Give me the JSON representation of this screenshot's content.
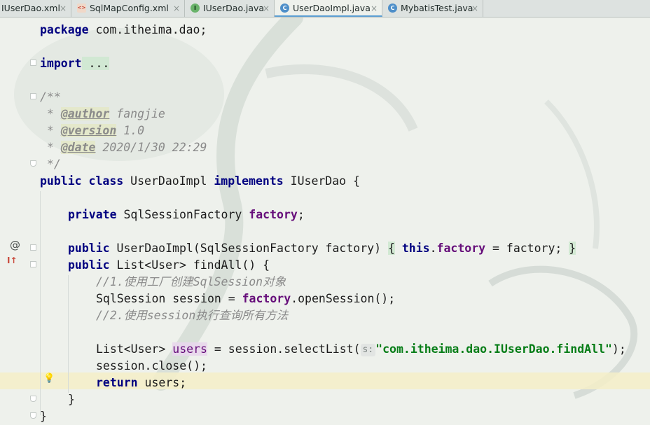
{
  "tabs": [
    {
      "label": "IUserDao.xml",
      "icon": "xml-file-icon",
      "active": false
    },
    {
      "label": "SqlMapConfig.xml",
      "icon": "xml-file-icon",
      "active": false
    },
    {
      "label": "IUserDao.java",
      "icon": "interface-icon",
      "active": false
    },
    {
      "label": "UserDaoImpl.java",
      "icon": "class-icon",
      "active": true
    },
    {
      "label": "MybatisTest.java",
      "icon": "class-icon",
      "active": false
    }
  ],
  "code": {
    "package_kw": "package",
    "package_name": " com.itheima.dao;",
    "import_kw": "import",
    "import_folded": " ...",
    "doc_open": "/**",
    "doc_star": " * ",
    "author_tag": "@author",
    "author_val": " fangjie",
    "version_tag": "@version",
    "version_val": " 1.0",
    "date_tag": "@date",
    "date_val": " 2020/1/30 22:29",
    "doc_close": " */",
    "kw_public": "public",
    "kw_class": "class",
    "class_name": " UserDaoImpl ",
    "kw_implements": "implements",
    "interface_name": " IUserDao {",
    "kw_private": "private",
    "field_type": " SqlSessionFactory ",
    "field_name": "factory",
    "semicolon": ";",
    "ctor_sig": " UserDaoImpl(SqlSessionFactory factory) ",
    "ctor_open": "{",
    "kw_this": "this",
    "dot": ".",
    "ctor_body_tail": " = factory; ",
    "ctor_close": "}",
    "find_sig": " List<User> findAll() {",
    "comment1": "//1.使用工厂创建SqlSession对象",
    "session_decl": "SqlSession session = ",
    "open_session": ".openSession();",
    "comment2": "//2.使用session执行查询所有方法",
    "list_decl": "List<User> ",
    "users_var": "users",
    "select_call": " = session.selectList(",
    "param_hint": "s:",
    "statement_str": "\"com.itheima.dao.IUserDao.findAll\"",
    "select_end": ");",
    "close_call": "session.close();",
    "kw_return": "return",
    "return_users": " users",
    "method_close": "}",
    "class_close": "}"
  },
  "gutter": {
    "override_marker": "@",
    "implements_marker": "I↑",
    "intention_bulb": "💡"
  }
}
